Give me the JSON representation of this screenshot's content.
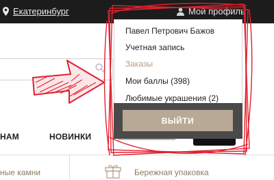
{
  "header": {
    "city": "Екатеринбург",
    "profile_label": "Мой профиль"
  },
  "nav": {
    "left_partial": "НАМ",
    "new": "НОВИНКИ"
  },
  "dropdown": {
    "items": [
      {
        "label": "Павел Петрович Бажов"
      },
      {
        "label": "Учетная запись"
      },
      {
        "label": "Заказы"
      },
      {
        "label": "Мои баллы (398)"
      },
      {
        "label": "Любимые украшения (2)"
      }
    ],
    "logout_label": "ВЫЙТИ"
  },
  "bottom_bar": {
    "left_partial": "ные камни",
    "packaging": "Бережная упаковка"
  },
  "colors": {
    "topbar": "#1c1c1c",
    "accent_gold": "#b89b82",
    "logout_button": "#b7a995",
    "annotation_red": "#e0202f"
  },
  "icons": [
    "location-pin-icon",
    "user-icon",
    "search-icon",
    "gift-icon"
  ]
}
